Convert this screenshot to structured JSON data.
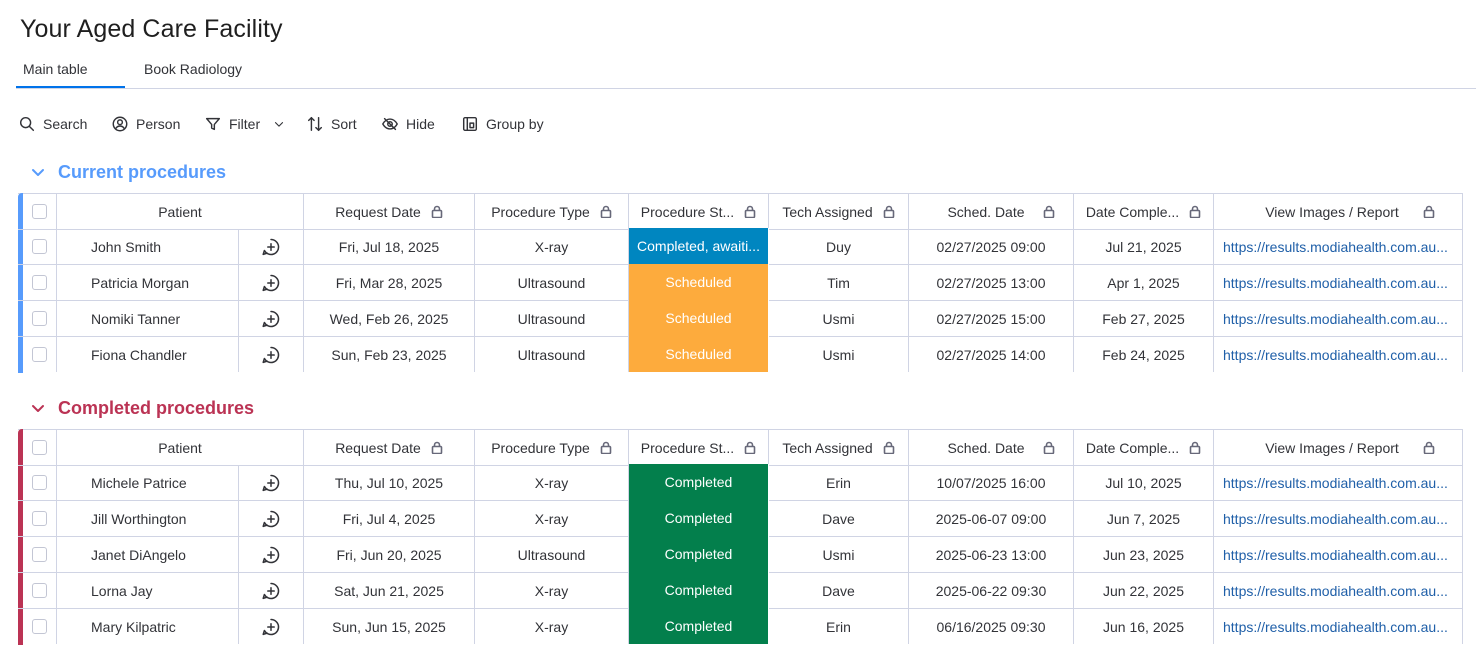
{
  "board": {
    "title": "Your Aged Care Facility"
  },
  "tabs": [
    {
      "label": "Main table"
    },
    {
      "label": "Book Radiology"
    }
  ],
  "toolbar": {
    "search": "Search",
    "person": "Person",
    "filter": "Filter",
    "sort": "Sort",
    "hide": "Hide",
    "group_by": "Group by"
  },
  "columns": {
    "patient": "Patient",
    "request_date": "Request Date",
    "procedure_type": "Procedure Type",
    "procedure_status": "Procedure St...",
    "tech_assigned": "Tech Assigned",
    "sched_date": "Sched. Date",
    "date_completed": "Date Comple...",
    "view_images": "View Images / Report"
  },
  "colors": {
    "current_group": "#579bfc",
    "completed_group": "#bb3354",
    "status_blue": "#0086c0",
    "status_orange": "#fdab3d",
    "status_green": "#037f4c",
    "link": "#1f5fa8"
  },
  "groups": [
    {
      "title": "Current procedures",
      "rows": [
        {
          "patient": "John Smith",
          "request_date": "Fri, Jul 18, 2025",
          "procedure_type": "X-ray",
          "status": "Completed, awaiti...",
          "status_color": "#0086c0",
          "tech": "Duy",
          "sched": "02/27/2025 09:00",
          "completed": "Jul 21, 2025",
          "link": "https://results.modiahealth.com.au..."
        },
        {
          "patient": "Patricia Morgan",
          "request_date": "Fri, Mar 28, 2025",
          "procedure_type": "Ultrasound",
          "status": "Scheduled",
          "status_color": "#fdab3d",
          "tech": "Tim",
          "sched": "02/27/2025 13:00",
          "completed": "Apr 1, 2025",
          "link": "https://results.modiahealth.com.au..."
        },
        {
          "patient": "Nomiki Tanner",
          "request_date": "Wed, Feb 26, 2025",
          "procedure_type": "Ultrasound",
          "status": "Scheduled",
          "status_color": "#fdab3d",
          "tech": "Usmi",
          "sched": "02/27/2025 15:00",
          "completed": "Feb 27, 2025",
          "link": "https://results.modiahealth.com.au..."
        },
        {
          "patient": "Fiona Chandler",
          "request_date": "Sun, Feb 23, 2025",
          "procedure_type": "Ultrasound",
          "status": "Scheduled",
          "status_color": "#fdab3d",
          "tech": "Usmi",
          "sched": "02/27/2025 14:00",
          "completed": "Feb 24, 2025",
          "link": "https://results.modiahealth.com.au..."
        }
      ]
    },
    {
      "title": "Completed procedures",
      "rows": [
        {
          "patient": "Michele Patrice",
          "request_date": "Thu, Jul 10, 2025",
          "procedure_type": "X-ray",
          "status": "Completed",
          "status_color": "#037f4c",
          "tech": "Erin",
          "sched": "10/07/2025 16:00",
          "completed": "Jul 10, 2025",
          "link": "https://results.modiahealth.com.au..."
        },
        {
          "patient": "Jill Worthington",
          "request_date": "Fri, Jul 4, 2025",
          "procedure_type": "X-ray",
          "status": "Completed",
          "status_color": "#037f4c",
          "tech": "Dave",
          "sched": "2025-06-07 09:00",
          "completed": "Jun 7, 2025",
          "link": "https://results.modiahealth.com.au..."
        },
        {
          "patient": "Janet DiAngelo",
          "request_date": "Fri, Jun 20, 2025",
          "procedure_type": "Ultrasound",
          "status": "Completed",
          "status_color": "#037f4c",
          "tech": "Usmi",
          "sched": "2025-06-23 13:00",
          "completed": "Jun 23, 2025",
          "link": "https://results.modiahealth.com.au..."
        },
        {
          "patient": "Lorna Jay",
          "request_date": "Sat, Jun 21, 2025",
          "procedure_type": "X-ray",
          "status": "Completed",
          "status_color": "#037f4c",
          "tech": "Dave",
          "sched": "2025-06-22 09:30",
          "completed": "Jun 22, 2025",
          "link": "https://results.modiahealth.com.au..."
        },
        {
          "patient": "Mary Kilpatric",
          "request_date": "Sun, Jun 15, 2025",
          "procedure_type": "X-ray",
          "status": "Completed",
          "status_color": "#037f4c",
          "tech": "Erin",
          "sched": "06/16/2025 09:30",
          "completed": "Jun 16, 2025",
          "link": "https://results.modiahealth.com.au..."
        }
      ]
    }
  ]
}
